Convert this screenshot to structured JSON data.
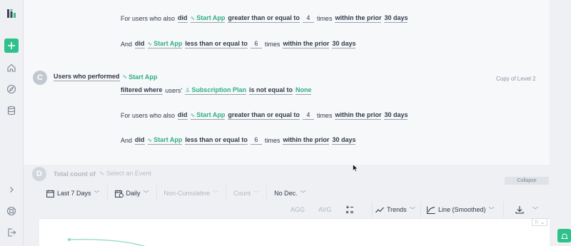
{
  "colors": {
    "accent": "#2fc18c",
    "event_text": "#2fae82",
    "text": "#313a4a"
  },
  "sidebar": {
    "icons": [
      "logo-icon",
      "plus-icon",
      "home-icon",
      "compass-icon",
      "database-icon",
      "chevron-right-icon",
      "help-icon",
      "logout-icon"
    ]
  },
  "query": {
    "top_block": {
      "line1": {
        "prefix": "For users who also",
        "did": "did",
        "event": "Start App",
        "op": "greater than or equal to",
        "value": "4",
        "times": "times",
        "within": "within the prior",
        "period": "30 days"
      },
      "line2": {
        "prefix": "And",
        "did": "did",
        "event": "Start App",
        "op": "less than or equal to",
        "value": "6",
        "times": "times",
        "within": "within the prior",
        "period": "30 days"
      }
    },
    "level_c": {
      "badge": "C",
      "title": "Users who performed",
      "event": "Start App",
      "copy_note": "Copy of Level 2",
      "filter": {
        "label": "filtered where",
        "scope": "users'",
        "property": "Subscription Plan",
        "op": "is not equal to",
        "value": "None"
      },
      "line1": {
        "prefix": "For users who also",
        "did": "did",
        "event": "Start App",
        "op": "greater than or equal to",
        "value": "4",
        "times": "times",
        "within": "within the prior",
        "period": "30 days"
      },
      "line2": {
        "prefix": "And",
        "did": "did",
        "event": "Start App",
        "op": "less than or equal to",
        "value": "6",
        "times": "times",
        "within": "within the prior",
        "period": "30 days"
      }
    },
    "level_d": {
      "badge": "D",
      "title": "Total count of",
      "placeholder": "Select an Event"
    },
    "collapse_label": "Collapse"
  },
  "toolbar": {
    "date_range": "Last 7 Days",
    "interval": "Daily",
    "cumulative": "Non-Cumulative",
    "metric": "Count",
    "decimals": "No Dec.",
    "agg": "AGG",
    "avg": "AVG",
    "trends": "Trends",
    "chart_type": "Line (Smoothed)"
  }
}
